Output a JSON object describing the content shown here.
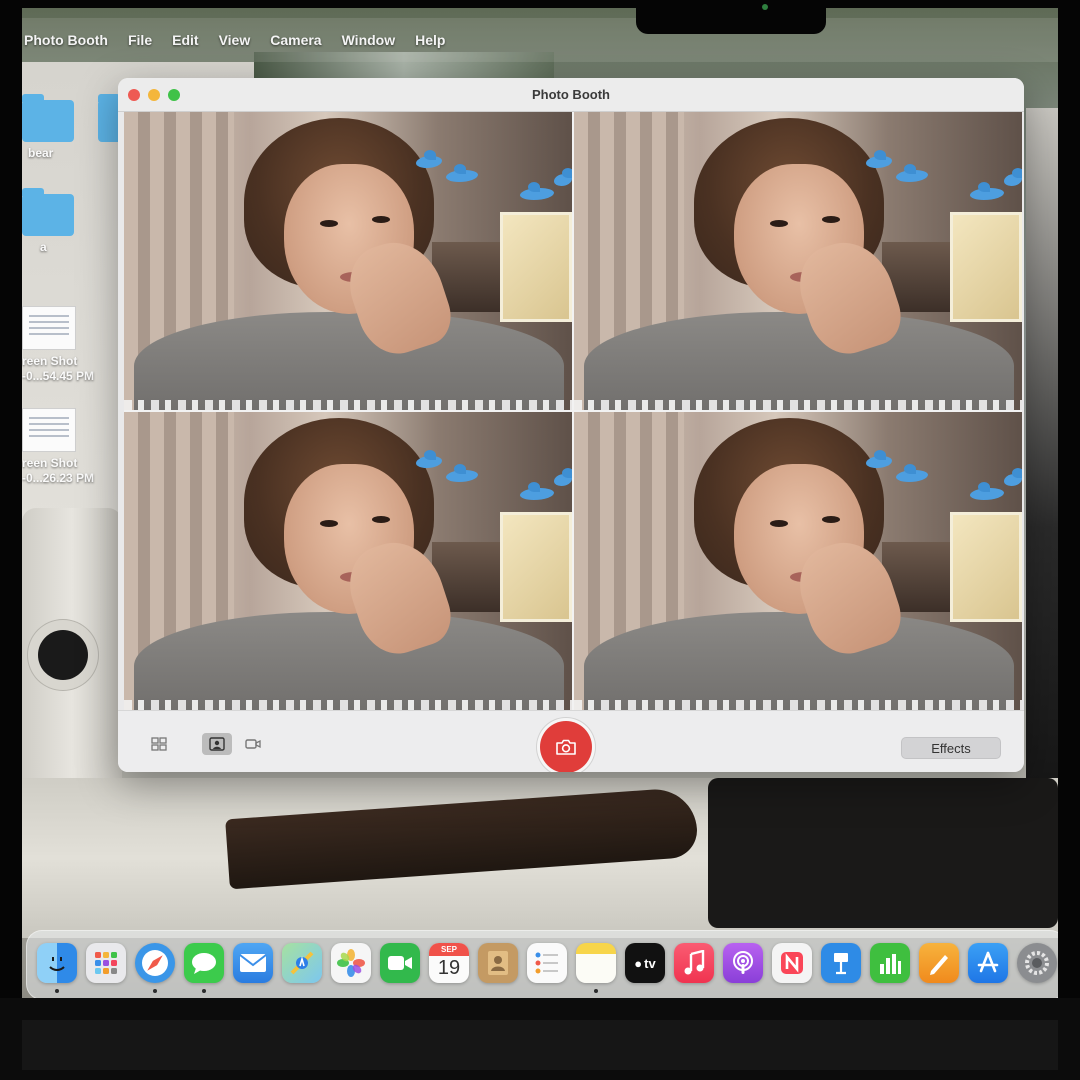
{
  "menubar": {
    "app_name": "Photo Booth",
    "items": [
      "File",
      "Edit",
      "View",
      "Camera",
      "Window",
      "Help"
    ]
  },
  "desktop": {
    "icons": [
      {
        "label": "bear",
        "kind": "folder"
      },
      {
        "label": "a",
        "kind": "folder"
      },
      {
        "label_line1": "reen Shot",
        "label_line2": "-0...54.45 PM",
        "kind": "screenshot"
      },
      {
        "label_line1": "reen Shot",
        "label_line2": "-0...26.23 PM",
        "kind": "screenshot"
      }
    ]
  },
  "window": {
    "title": "Photo Booth",
    "traffic_lights": {
      "close": "#ee5a53",
      "minimize": "#f4b63b",
      "zoom": "#3fc248"
    },
    "grid_tiles": 4,
    "toolbar": {
      "modes": [
        "grid-icon",
        "portrait-icon",
        "video-icon"
      ],
      "active_mode": "portrait-icon",
      "shutter_icon": "camera-icon",
      "shutter_color": "#e03d3a",
      "effects_label": "Effects"
    }
  },
  "dock": {
    "calendar": {
      "month": "SEP",
      "day": "19"
    },
    "apps": [
      {
        "name": "finder-icon",
        "color": "#2f8ae8",
        "running": true
      },
      {
        "name": "launchpad-icon",
        "color": "#e9e9ec",
        "running": false
      },
      {
        "name": "safari-icon",
        "color": "#3a96e8",
        "running": true
      },
      {
        "name": "messages-icon",
        "color": "#3ccb4c",
        "running": true
      },
      {
        "name": "mail-icon",
        "color": "#3b8fe9",
        "running": false
      },
      {
        "name": "maps-icon",
        "color": "#66c36b",
        "running": false
      },
      {
        "name": "photos-icon",
        "color": "#f6f6f6",
        "running": false
      },
      {
        "name": "facetime-icon",
        "color": "#32b94c",
        "running": false
      },
      {
        "name": "calendar-icon",
        "color": "#fbfbfb",
        "running": false
      },
      {
        "name": "contacts-icon",
        "color": "#c49a63",
        "running": false
      },
      {
        "name": "reminders-icon",
        "color": "#fafafa",
        "running": false
      },
      {
        "name": "notes-icon",
        "color": "#f7d54a",
        "running": true
      },
      {
        "name": "tv-icon",
        "color": "#111111",
        "label": "tv",
        "running": false
      },
      {
        "name": "music-icon",
        "color": "#f3455d",
        "running": false
      },
      {
        "name": "podcasts-icon",
        "color": "#9b4fe0",
        "running": false
      },
      {
        "name": "news-icon",
        "color": "#f4f4f4",
        "running": false
      },
      {
        "name": "keynote-icon",
        "color": "#2e8be6",
        "running": false
      },
      {
        "name": "numbers-icon",
        "color": "#3fbf3f",
        "running": false
      },
      {
        "name": "pages-icon",
        "color": "#f29d2b",
        "running": false
      },
      {
        "name": "app-store-icon",
        "color": "#2c8cf0",
        "running": false
      },
      {
        "name": "system-preferences-icon",
        "color": "#8b8d90",
        "running": false
      }
    ]
  }
}
